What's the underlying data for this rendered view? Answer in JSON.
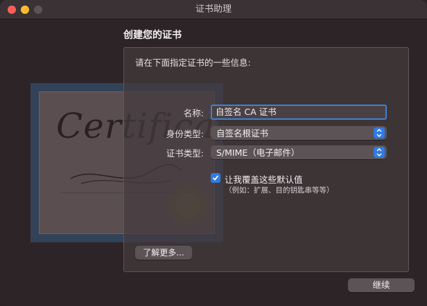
{
  "window": {
    "title": "证书助理"
  },
  "art": {
    "cert_word": "Certificate"
  },
  "page": {
    "heading": "创建您的证书",
    "intro": "请在下面指定证书的一些信息:"
  },
  "form": {
    "name_label": "名称:",
    "name_value": "自签名 CA 证书",
    "identity_label": "身份类型:",
    "identity_value": "自签名根证书",
    "cert_type_label": "证书类型:",
    "cert_type_value": "S/MIME（电子邮件）",
    "override_label": "让我覆盖这些默认值",
    "override_note": "（例如：扩展、目的钥匙串等等）",
    "override_checked": true
  },
  "buttons": {
    "learn_more": "了解更多...",
    "continue": "继续"
  },
  "colors": {
    "accent": "#2f7be6",
    "focus_ring": "#3d83d8",
    "close": "#fe5f57",
    "minimize": "#febc2e"
  }
}
